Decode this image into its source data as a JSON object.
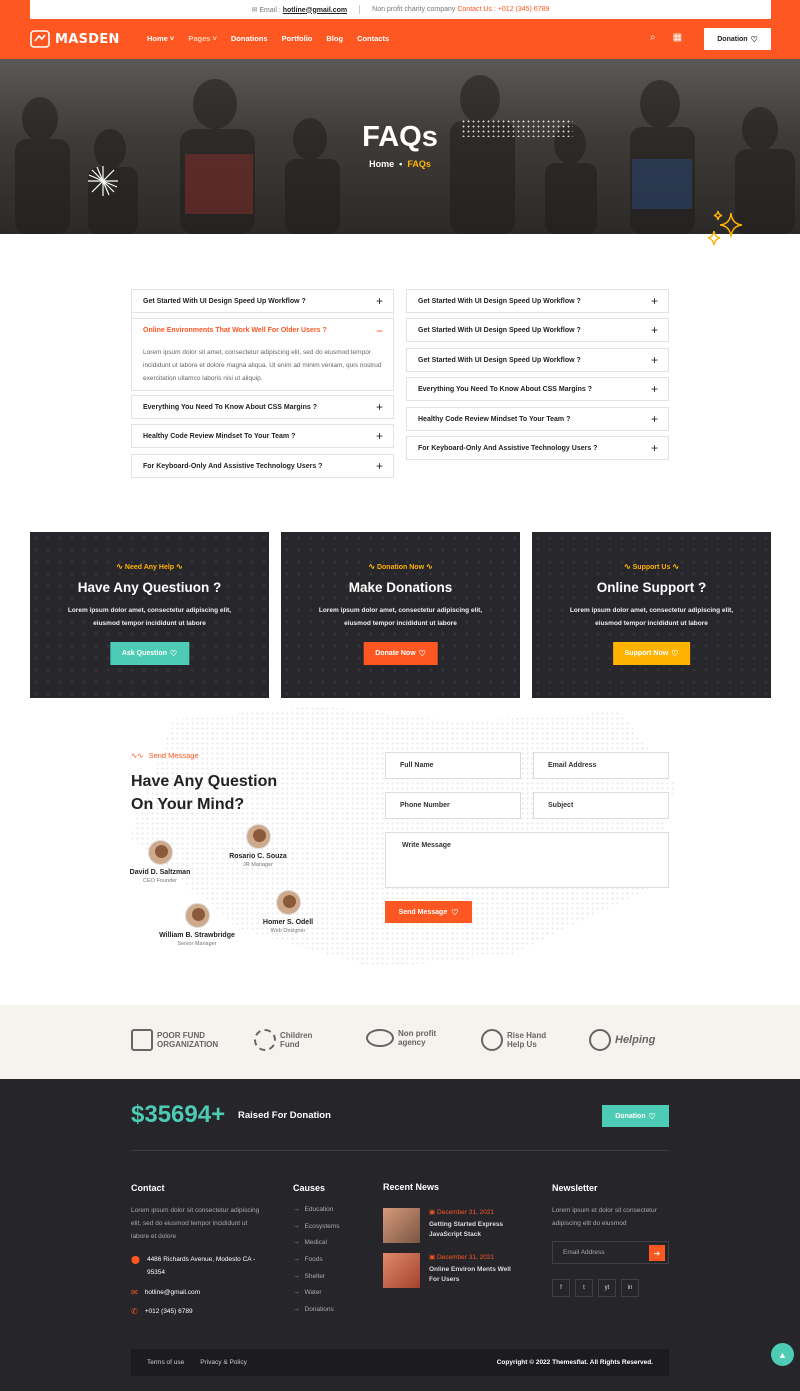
{
  "topbar": {
    "email_label": "Email :",
    "email": "hotline@gmail.com",
    "note": "Non profit charity company",
    "contact_label": "Contact Us :",
    "phone": "+012 (345) 6789"
  },
  "nav": {
    "brand": "MASDEN",
    "menu": [
      "Home",
      "Pages",
      "Donations",
      "Portfolio",
      "Blog",
      "Contacts"
    ],
    "active_item": "Pages",
    "donation_label": "Donation"
  },
  "hero": {
    "title": "FAQs",
    "crumb_home": "Home",
    "crumb_sep": "•",
    "crumb_current": "FAQs"
  },
  "faq_left": [
    {
      "q": "Get Started With UI Design Speed Up Workflow ?",
      "open": false
    },
    {
      "q": "Online Environments That Work Well For Older Users ?",
      "open": true
    },
    {
      "q": "Everything You Need To Know About CSS Margins ?",
      "open": false
    },
    {
      "q": "Healthy Code Review Mindset To Your Team ?",
      "open": false
    },
    {
      "q": "For Keyboard-Only And Assistive Technology Users ?",
      "open": false
    }
  ],
  "faq_answer": "Lorem ipsum dolor sit amet, consectetur adipiscing elit, sed do eiusmod tempor incididunt ut labore et dolore magna aliqua. Ut enim ad minim veniam, quis nostrud exercitation ullamco laboris nisi ut aliquip.",
  "faq_right": [
    "Get Started With UI Design Speed Up Workflow ?",
    "Get Started With UI Design Speed Up Workflow ?",
    "Get Started With UI Design Speed Up Workflow ?",
    "Everything You Need To Know About CSS Margins ?",
    "Healthy Code Review Mindset To Your Team ?",
    "For Keyboard-Only And Assistive Technology Users ?"
  ],
  "cards": [
    {
      "sub": "Need Any Help",
      "title": "Have Any Questiuon ?",
      "text": "Lorem ipsum dolor amet, consectetur adipiscing elit, eiusmod tempor incididunt ut labore",
      "button": "Ask Question",
      "color": "#4ecbb4",
      "sub_color": "#ffb300"
    },
    {
      "sub": "Donation Now",
      "title": "Make Donations",
      "text": "Lorem ipsum dolor amet, consectetur adipiscing elit, eiusmod tempor incididunt ut labore",
      "button": "Donate Now",
      "color": "#ff5722",
      "sub_color": "#ffb300"
    },
    {
      "sub": "Support Us",
      "title": "Online Support ?",
      "text": "Lorem ipsum dolor amet, consectetur adipiscing elit, eiusmod tempor incididunt ut labore",
      "button": "Support Now",
      "color": "#ffb300",
      "sub_color": "#ffb300"
    }
  ],
  "message": {
    "sub": "Send Message",
    "title_line1": "Have Any Question",
    "title_line2": "On Your Mind?",
    "people": [
      {
        "name": "David D. Saltzman",
        "role": "CEO Founder"
      },
      {
        "name": "Rosario C. Souza",
        "role": "JR Manager"
      },
      {
        "name": "William B. Strawbridge",
        "role": "Senior Manager"
      },
      {
        "name": "Homer S. Odell",
        "role": "Web Designer"
      }
    ],
    "form": {
      "full_name": "Full Name",
      "email": "Email Address",
      "phone": "Phone Number",
      "subject": "Subject",
      "message": "Write Message",
      "send": "Send Message"
    }
  },
  "partners": [
    {
      "line1": "POOR FUND",
      "line2": "ORGANIZATION"
    },
    {
      "line1": "Children",
      "line2": "Fund"
    },
    {
      "line1": "Non profit",
      "line2": "agency"
    },
    {
      "line1": "Rise Hand",
      "line2": "Help Us"
    },
    {
      "line1": "Helping",
      "line2": ""
    }
  ],
  "footer": {
    "raised_amount": "$35694+",
    "raised_label": "Raised For Donation",
    "donation_button": "Donation",
    "contact": {
      "heading": "Contact",
      "text": "Lorem ipsum dolor sit consectetur adipiscing elit, sed do eiusmod tempor incididunt ut labore et dolore",
      "address": "4486 Richards Avenue, Modesto CA - 95354",
      "email": "hotline@gmail.com",
      "phone": "+012 (345) 6789"
    },
    "causes": {
      "heading": "Causes",
      "items": [
        "Education",
        "Ecosystems",
        "Medical",
        "Foods",
        "Shelter",
        "Water",
        "Donations"
      ]
    },
    "news": {
      "heading": "Recent News",
      "items": [
        {
          "date": "December 31, 2021",
          "title": "Getting Started Express JavaScript Stack"
        },
        {
          "date": "December 31, 2021",
          "title": "Online Environ Ments Well For Users"
        }
      ]
    },
    "newsletter": {
      "heading": "Newsletter",
      "text": "Lorem ipsum et dolor sit consectetur adipiscing elit do eiusmod",
      "placeholder": "Email Address",
      "social": [
        "f",
        "t",
        "yt",
        "in"
      ]
    },
    "links": [
      "Terms of use",
      "Privacy & Policy"
    ],
    "copyright": "Copyright © 2022 Themesflat. All Rights Reserved."
  }
}
